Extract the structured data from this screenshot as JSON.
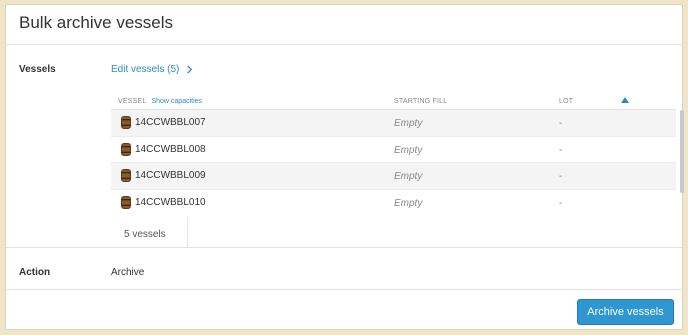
{
  "dialog": {
    "title": "Bulk archive vessels"
  },
  "vessels": {
    "label": "Vessels",
    "edit_link": "Edit vessels (5)",
    "columns": {
      "vessel": "VESSEL",
      "show_capacities": "Show capacities",
      "starting_fill": "STARTING FILL",
      "lot": "LOT"
    },
    "rows": [
      {
        "name": "14CCWBBL007",
        "fill": "Empty",
        "lot": "-"
      },
      {
        "name": "14CCWBBL008",
        "fill": "Empty",
        "lot": "-"
      },
      {
        "name": "14CCWBBL009",
        "fill": "Empty",
        "lot": "-"
      },
      {
        "name": "14CCWBBL010",
        "fill": "Empty",
        "lot": "-"
      }
    ],
    "count": "5 vessels"
  },
  "action": {
    "label": "Action",
    "value": "Archive"
  },
  "footer": {
    "submit_label": "Archive vessels"
  },
  "icons": {
    "row_icon": "barrel-icon",
    "sort": "sort-ascending-icon",
    "edit_chevron": "chevron-right-icon"
  },
  "colors": {
    "accent": "#2e97d2",
    "link": "#2e8cc4",
    "backdrop": "#efe5c8"
  }
}
